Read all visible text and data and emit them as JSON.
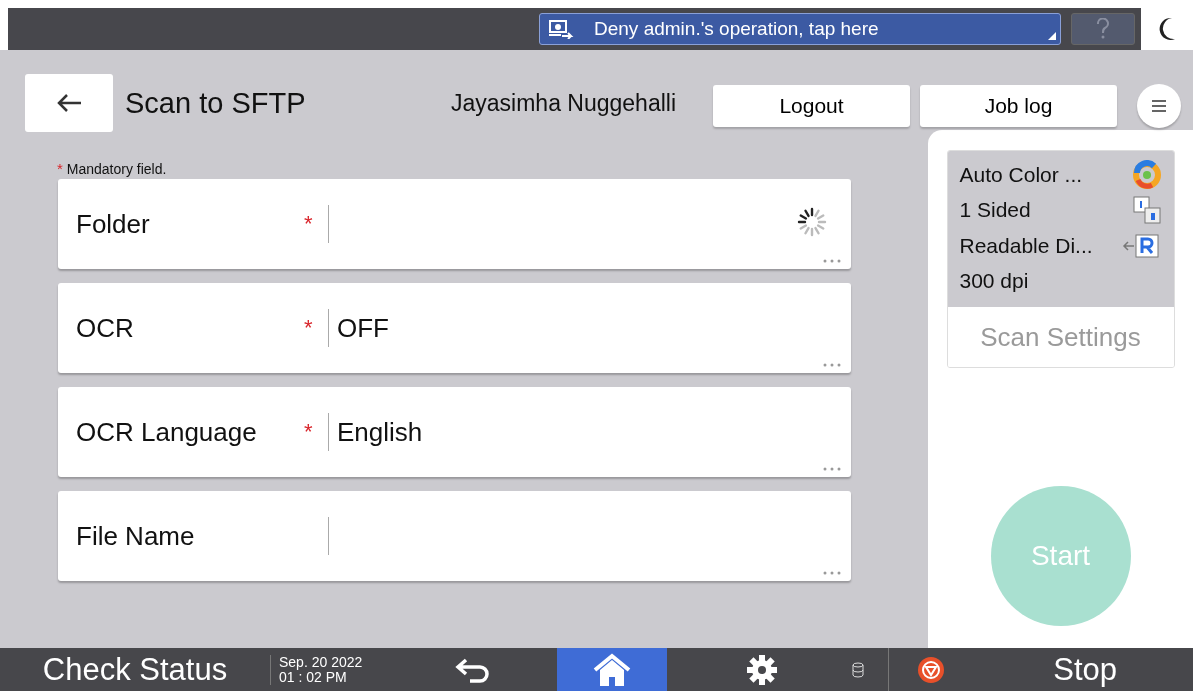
{
  "notice": {
    "text": "Deny admin.'s operation, tap here"
  },
  "header": {
    "title": "Scan to SFTP",
    "user": "Jayasimha Nuggehalli",
    "buttons": [
      "Logout",
      "Job log"
    ]
  },
  "mandatory_note": {
    "mark": "*",
    "text": "Mandatory field."
  },
  "fields": [
    {
      "label": "Folder",
      "mark": "*",
      "loading": true
    },
    {
      "label": "OCR",
      "mark": "*",
      "value": "OFF",
      "loading": false
    },
    {
      "label": "OCR Language",
      "mark": "*",
      "value": "English",
      "loading": false
    },
    {
      "label": "File Name",
      "loading": false
    }
  ],
  "settings": {
    "items": [
      {
        "text": "Auto Color ...",
        "kind": "color"
      },
      {
        "text": "1 Sided",
        "kind": "sided"
      },
      {
        "text": "Readable Di...",
        "kind": "direction"
      },
      {
        "text": "300 dpi",
        "kind": "none"
      }
    ],
    "button": "Scan Settings"
  },
  "start": {
    "label": "Start",
    "disabled": true
  },
  "bottom_bar": {
    "check_status": "Check Status",
    "date": "Sep. 20 2022",
    "time": "01 : 02 PM",
    "stop": "Stop"
  }
}
